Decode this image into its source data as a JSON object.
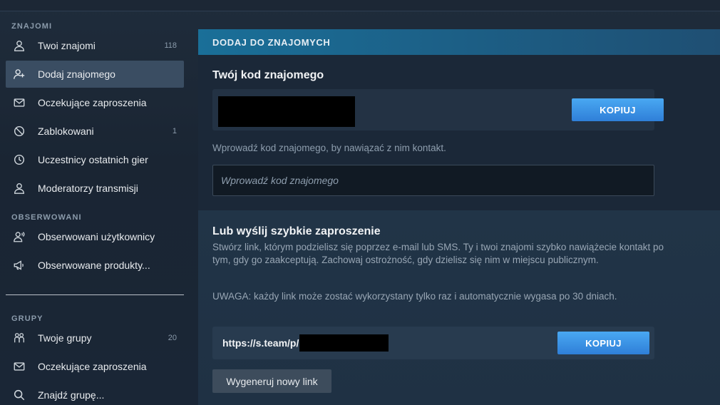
{
  "sidebar": {
    "sections": {
      "friends": "ZNAJOMI",
      "following": "OBSERWOWANI",
      "groups": "GRUPY"
    },
    "friends_items": [
      {
        "label": "Twoi znajomi",
        "count": "118",
        "icon": "person-icon"
      },
      {
        "label": "Dodaj znajomego",
        "count": "",
        "icon": "add-person-icon",
        "active": true
      },
      {
        "label": "Oczekujące zaproszenia",
        "count": "",
        "icon": "envelope-icon"
      },
      {
        "label": "Zablokowani",
        "count": "1",
        "icon": "blocked-icon"
      },
      {
        "label": "Uczestnicy ostatnich gier",
        "count": "",
        "icon": "clock-icon"
      },
      {
        "label": "Moderatorzy transmisji",
        "count": "",
        "icon": "person-icon"
      }
    ],
    "following_items": [
      {
        "label": "Obserwowani użytkownicy",
        "icon": "person-broadcast-icon"
      },
      {
        "label": "Obserwowane produkty...",
        "icon": "megaphone-icon"
      }
    ],
    "groups_items": [
      {
        "label": "Twoje grupy",
        "count": "20",
        "icon": "group-icon"
      },
      {
        "label": "Oczekujące zaproszenia",
        "count": "",
        "icon": "envelope-icon"
      },
      {
        "label": "Znajdź grupę...",
        "count": "",
        "icon": "search-icon"
      }
    ]
  },
  "main": {
    "header": "DODAJ DO ZNAJOMYCH",
    "friend_code": {
      "heading": "Twój kod znajomego",
      "copy_label": "KOPIUJ",
      "hint": "Wprowadź kod znajomego, by nawiązać z nim kontakt.",
      "input_placeholder": "Wprowadź kod znajomego"
    },
    "quick_invite": {
      "heading": "Lub wyślij szybkie zaproszenie",
      "description": "Stwórz link, którym podzielisz się poprzez e-mail lub SMS. Ty i twoi znajomi szybko nawiążecie kontakt po tym, gdy go zaakceptują. Zachowaj ostrożność, gdy dzielisz się nim w miejscu publicznym.",
      "warning": "UWAGA: każdy link może zostać wykorzystany tylko raz i automatycznie wygasa po 30 dniach.",
      "link_text": "https://s.team/p/",
      "copy_label": "KOPIUJ",
      "generate_label": "Wygeneruj nowy link"
    }
  },
  "colors": {
    "accent_blue": "#3a8fe0",
    "header_blue": "#1a6f98",
    "active_item": "#3a4d62"
  }
}
